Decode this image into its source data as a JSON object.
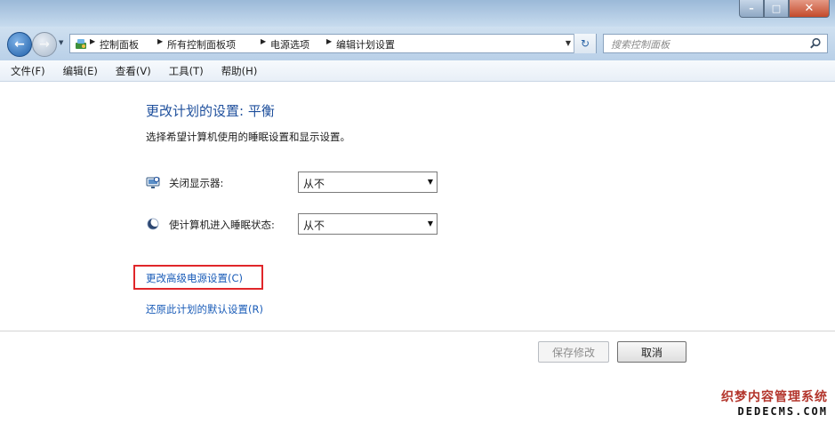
{
  "window": {
    "caption": {
      "minimize": "–",
      "maximize": "□",
      "close": "✕"
    }
  },
  "navigation": {
    "breadcrumbs": [
      "控制面板",
      "所有控制面板项",
      "电源选项",
      "编辑计划设置"
    ],
    "search_placeholder": "搜索控制面板"
  },
  "menu": [
    "文件(F)",
    "编辑(E)",
    "查看(V)",
    "工具(T)",
    "帮助(H)"
  ],
  "content": {
    "title": "更改计划的设置: 平衡",
    "description": "选择希望计算机使用的睡眠设置和显示设置。",
    "settings": [
      {
        "label": "关闭显示器:",
        "value": "从不",
        "icon": "monitor-icon"
      },
      {
        "label": "使计算机进入睡眠状态:",
        "value": "从不",
        "icon": "moon-icon"
      }
    ],
    "links": {
      "advanced": "更改高级电源设置(C)",
      "restore": "还原此计划的默认设置(R)"
    },
    "buttons": {
      "save": "保存修改",
      "cancel": "取消"
    }
  },
  "watermark": {
    "cn": "织梦内容管理系统",
    "en": "DEDECMS.COM"
  },
  "colors": {
    "accent": "#1e4f9c",
    "link": "#1a5cb8",
    "highlight": "#e0262a",
    "chrome": "#b9d0e8"
  }
}
